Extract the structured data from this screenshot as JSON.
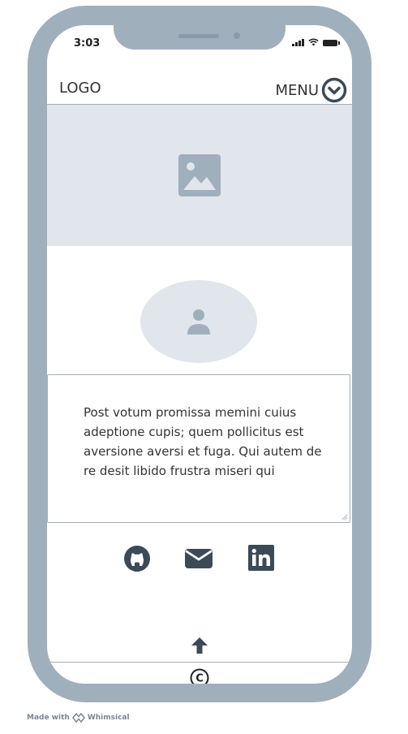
{
  "status_bar": {
    "time": "3:03"
  },
  "header": {
    "logo": "LOGO",
    "menu_label": "MENU"
  },
  "content": {
    "paragraph": "Post votum promissa memini cuius adeptione cupis; quem pollicitus est aversione aversi et fuga. Qui autem de re desit libido frustra miseri qui"
  },
  "footer": {
    "copyright_symbol": "©"
  },
  "watermark": {
    "made_with": "Made with",
    "brand": "Whimsical"
  },
  "colors": {
    "frame": "#a0afbc",
    "placeholder": "#e1e5ec",
    "icon": "#3c4a57"
  }
}
